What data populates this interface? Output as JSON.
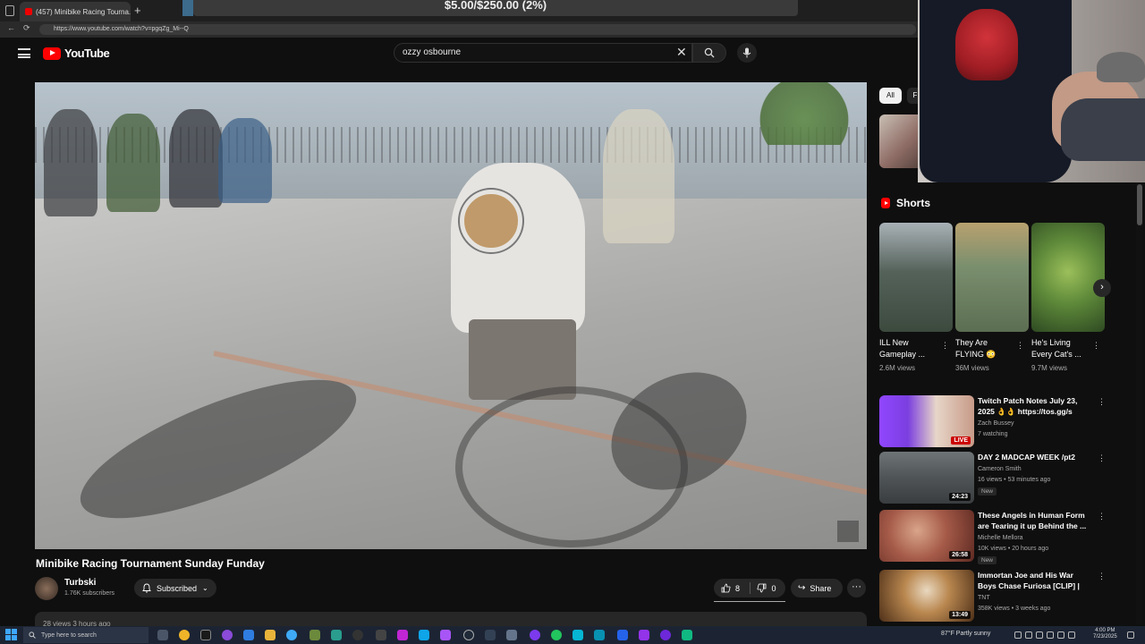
{
  "browser": {
    "tab_title": "(457) Minibike Racing Tourna...",
    "address": "https://www.youtube.com/watch?v=pgqZg_Mi--Q"
  },
  "overlay": {
    "goal_text": "$5.00/$250.00 (2%)"
  },
  "header": {
    "logo_text": "YouTube",
    "search_value": "ozzy osbourne"
  },
  "video": {
    "title": "Minibike Racing Tournament Sunday Funday",
    "channel_name": "Turbski",
    "channel_subs": "1.76K subscribers",
    "subscribe_label": "Subscribed",
    "likes": "8",
    "dislikes": "0",
    "share_label": "Share",
    "desc_peek": "28 views  3 hours ago"
  },
  "sidebar": {
    "chips": [
      "All",
      "F"
    ],
    "shorts_heading": "Shorts",
    "shorts": [
      {
        "title": "ILL New Gameplay ...",
        "views": "2.6M views"
      },
      {
        "title": "They Are FLYING 😳",
        "views": "36M views"
      },
      {
        "title": "He's Living Every Cat's ...",
        "views": "9.7M views"
      }
    ],
    "recommendations": [
      {
        "title": "Twitch Patch Notes July 23, 2025 👌👌 https://tos.gg/s",
        "channel": "Zach Bussey",
        "meta": "7 watching",
        "badge_label": "LIVE",
        "badge": ""
      },
      {
        "title": "DAY 2 MADCAP WEEK /pt2",
        "channel": "Cameron Smith",
        "meta": "16 views • 53 minutes ago",
        "duration": "24:23",
        "badge": "New"
      },
      {
        "title": "These Angels in Human Form are Tearing it up Behind the ...",
        "channel": "Michelle Mellora",
        "meta": "10K views • 20 hours ago",
        "duration": "26:58",
        "badge": "New"
      },
      {
        "title": "Immortan Joe and His War Boys Chase Furiosa [CLIP] | Mad Ma...",
        "channel": "TNT",
        "meta": "358K views • 3 weeks ago",
        "duration": "13:49",
        "badge": ""
      }
    ]
  },
  "taskbar": {
    "search_placeholder": "Type here to search",
    "weather": "87°F  Partly sunny",
    "time": "4:00 PM",
    "date": "7/23/2025"
  },
  "colors": {
    "accent_red": "#ff0000",
    "background": "#0f0f0f",
    "live_red": "#cc0000"
  }
}
